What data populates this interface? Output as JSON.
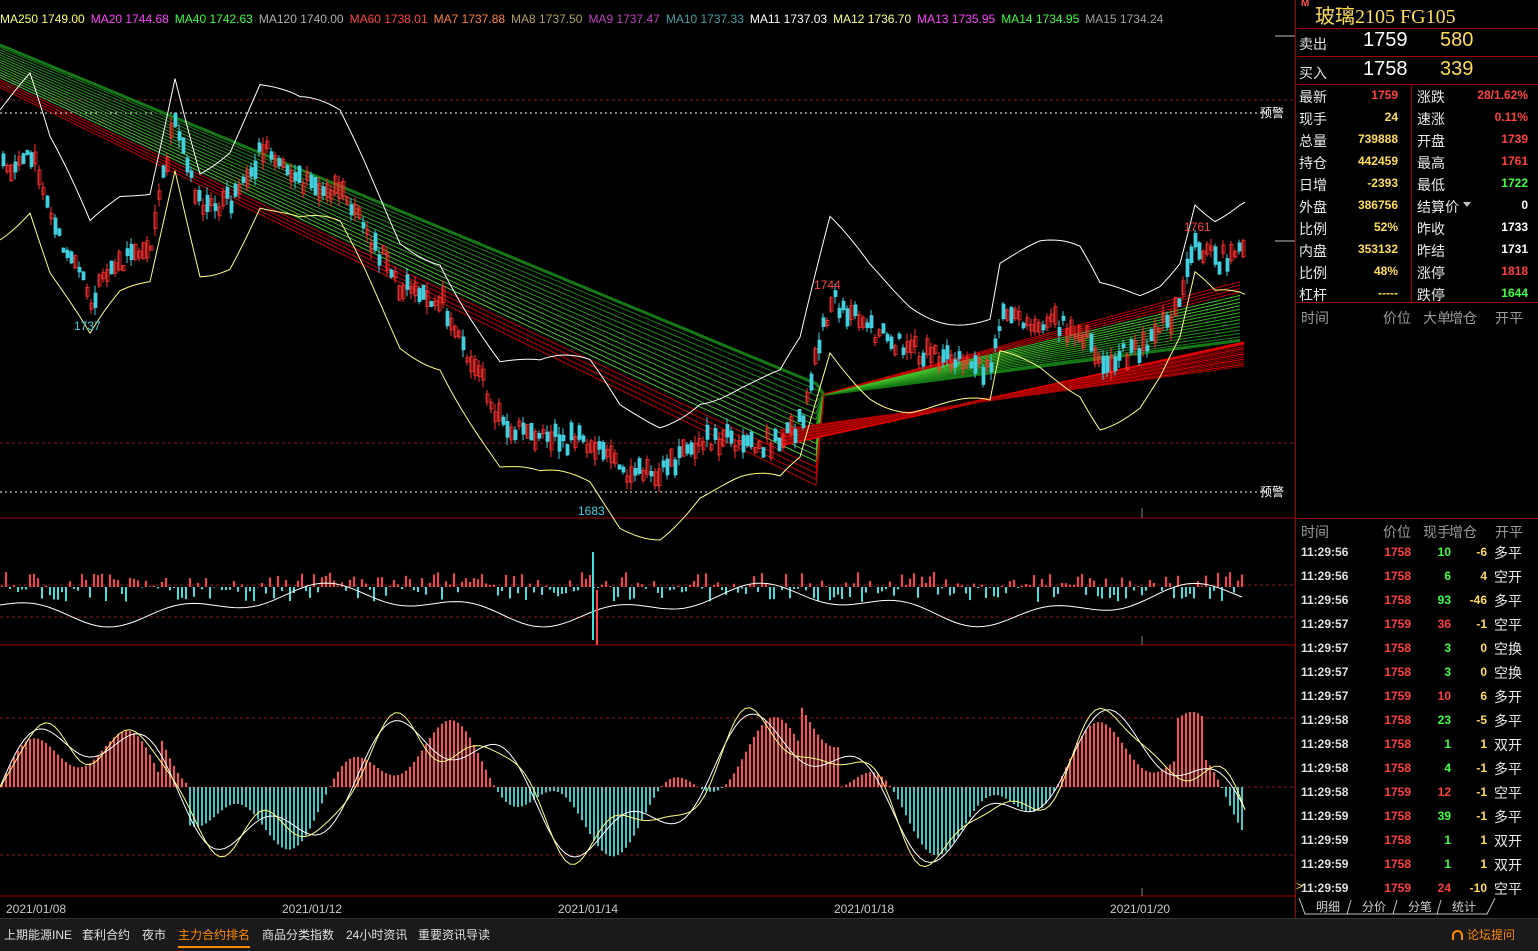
{
  "ma_bar": [
    {
      "label": "MA250",
      "value": "1749.00",
      "color": "#ffff66"
    },
    {
      "label": "MA20",
      "value": "1744.68",
      "color": "#ff40ff"
    },
    {
      "label": "MA40",
      "value": "1742.63",
      "color": "#40ff40"
    },
    {
      "label": "MA120",
      "value": "1740.00",
      "color": "#b0b0b0"
    },
    {
      "label": "MA60",
      "value": "1738.01",
      "color": "#ff4040"
    },
    {
      "label": "MA7",
      "value": "1737.88",
      "color": "#ff8040"
    },
    {
      "label": "MA8",
      "value": "1737.50",
      "color": "#b0a060"
    },
    {
      "label": "MA9",
      "value": "1737.47",
      "color": "#c040c0"
    },
    {
      "label": "MA10",
      "value": "1737.33",
      "color": "#40a0a0"
    },
    {
      "label": "MA11",
      "value": "1737.03",
      "color": "#ffffff"
    },
    {
      "label": "MA12",
      "value": "1736.70",
      "color": "#ffff80"
    },
    {
      "label": "MA13",
      "value": "1735.95",
      "color": "#ff40ff"
    },
    {
      "label": "MA14",
      "value": "1734.95",
      "color": "#40ff40"
    },
    {
      "label": "MA15",
      "value": "1734.24",
      "color": "#a0a0a0"
    }
  ],
  "chart_labels": {
    "low_1737": "1737",
    "low_1683": "1683",
    "high_1744": "1744",
    "high_1761": "1761",
    "alert_top": "预警",
    "alert_bottom": "预警"
  },
  "dates": [
    "2021/01/08",
    "2021/01/12",
    "2021/01/14",
    "2021/01/18",
    "2021/01/20"
  ],
  "instrument": {
    "badge": "M",
    "title": "玻璃2105  FG105"
  },
  "order_book": [
    {
      "label": "卖出",
      "price": "1759",
      "volume": "580"
    },
    {
      "label": "买入",
      "price": "1758",
      "volume": "339"
    }
  ],
  "quote": [
    {
      "l1": "最新",
      "v1": "1759",
      "c1": "#ff4040",
      "l2": "涨跌",
      "v2": "28/1.62%",
      "c2": "#ff4040"
    },
    {
      "l1": "现手",
      "v1": "24",
      "c1": "#ffdd55",
      "l2": "速涨",
      "v2": "0.11%",
      "c2": "#ff4040"
    },
    {
      "l1": "总量",
      "v1": "739888",
      "c1": "#ffdd55",
      "l2": "开盘",
      "v2": "1739",
      "c2": "#ff4040"
    },
    {
      "l1": "持仓",
      "v1": "442459",
      "c1": "#ffdd55",
      "l2": "最高",
      "v2": "1761",
      "c2": "#ff4040"
    },
    {
      "l1": "日增",
      "v1": "-2393",
      "c1": "#ffdd55",
      "l2": "最低",
      "v2": "1722",
      "c2": "#40ff40"
    },
    {
      "l1": "外盘",
      "v1": "386756",
      "c1": "#ffdd55",
      "l2": "结算价",
      "v2": "0",
      "c2": "#ffffff"
    },
    {
      "l1": "比例",
      "v1": "52%",
      "c1": "#ffdd55",
      "l2": "昨收",
      "v2": "1733",
      "c2": "#ffffff"
    },
    {
      "l1": "内盘",
      "v1": "353132",
      "c1": "#ffdd55",
      "l2": "昨结",
      "v2": "1731",
      "c2": "#ffffff"
    },
    {
      "l1": "比例",
      "v1": "48%",
      "c1": "#ffdd55",
      "l2": "涨停",
      "v2": "1818",
      "c2": "#ff4040"
    },
    {
      "l1": "杠杆",
      "v1": "-----",
      "c1": "#ffdd55",
      "l2": "跌停",
      "v2": "1644",
      "c2": "#40ff40"
    }
  ],
  "big_trade_headers": [
    "时间",
    "价位",
    "大单",
    "增仓",
    "开平"
  ],
  "tick_headers": [
    "时间",
    "价位",
    "现手",
    "增仓",
    "开平"
  ],
  "ticks": [
    {
      "time": "11:29:56",
      "price": "1758",
      "vol": "10",
      "vc": "#40ff40",
      "oi": "-6",
      "oc": "#ffdd55",
      "type": "多平"
    },
    {
      "time": "11:29:56",
      "price": "1758",
      "vol": "6",
      "vc": "#40ff40",
      "oi": "4",
      "oc": "#ffdd55",
      "type": "空开"
    },
    {
      "time": "11:29:56",
      "price": "1758",
      "vol": "93",
      "vc": "#40ff40",
      "oi": "-46",
      "oc": "#ffdd55",
      "type": "多平"
    },
    {
      "time": "11:29:57",
      "price": "1759",
      "vol": "36",
      "vc": "#ff4040",
      "oi": "-1",
      "oc": "#ffdd55",
      "type": "空平"
    },
    {
      "time": "11:29:57",
      "price": "1758",
      "vol": "3",
      "vc": "#40ff40",
      "oi": "0",
      "oc": "#ffdd55",
      "type": "空换"
    },
    {
      "time": "11:29:57",
      "price": "1758",
      "vol": "3",
      "vc": "#40ff40",
      "oi": "0",
      "oc": "#ffdd55",
      "type": "空换"
    },
    {
      "time": "11:29:57",
      "price": "1759",
      "vol": "10",
      "vc": "#ff4040",
      "oi": "6",
      "oc": "#ffdd55",
      "type": "多开"
    },
    {
      "time": "11:29:58",
      "price": "1758",
      "vol": "23",
      "vc": "#40ff40",
      "oi": "-5",
      "oc": "#ffdd55",
      "type": "多平"
    },
    {
      "time": "11:29:58",
      "price": "1758",
      "vol": "1",
      "vc": "#40ff40",
      "oi": "1",
      "oc": "#ffdd55",
      "type": "双开"
    },
    {
      "time": "11:29:58",
      "price": "1758",
      "vol": "4",
      "vc": "#40ff40",
      "oi": "-1",
      "oc": "#ffdd55",
      "type": "多平"
    },
    {
      "time": "11:29:58",
      "price": "1759",
      "vol": "12",
      "vc": "#ff4040",
      "oi": "-1",
      "oc": "#ffdd55",
      "type": "空平"
    },
    {
      "time": "11:29:59",
      "price": "1758",
      "vol": "39",
      "vc": "#40ff40",
      "oi": "-1",
      "oc": "#ffdd55",
      "type": "多平"
    },
    {
      "time": "11:29:59",
      "price": "1758",
      "vol": "1",
      "vc": "#40ff40",
      "oi": "1",
      "oc": "#ffdd55",
      "type": "双开"
    },
    {
      "time": "11:29:59",
      "price": "1758",
      "vol": "1",
      "vc": "#40ff40",
      "oi": "1",
      "oc": "#ffdd55",
      "type": "双开"
    },
    {
      "time": "11:29:59",
      "price": "1759",
      "vol": "24",
      "vc": "#ff4040",
      "oi": "-10",
      "oc": "#ffdd55",
      "type": "空平"
    }
  ],
  "panel_tabs": [
    "明细",
    "分价",
    "分笔",
    "统计"
  ],
  "status_tabs": [
    "上期能源INE",
    "套利合约",
    "夜市",
    "主力合约排名",
    "商品分类指数",
    "24小时资讯",
    "重要资讯导读"
  ],
  "status_active": "主力合约排名",
  "forum_link": "论坛提问",
  "colors": {
    "up": "#ff4040",
    "down": "#40e0e0",
    "border": "#a00000",
    "accent": "#ffdd55"
  }
}
